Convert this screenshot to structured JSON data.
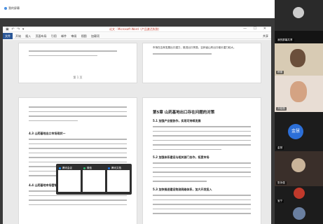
{
  "callbar": {
    "title": "我的屏幕"
  },
  "word": {
    "doc_title": "论文 - Microsoft Word（产品激活失败）",
    "quick_access": "▣ ↶ ↷ ▾",
    "window_controls": "— ☐ ✕",
    "file_tab": "文件",
    "tabs": [
      "开始",
      "插入",
      "页面布局",
      "引用",
      "邮件",
      "审阅",
      "视图",
      "加载项"
    ],
    "share": "共享"
  },
  "pages": {
    "top_right_line": "市场在吉林发展出口潜力，推进出口贸易，吉林省山药出口增长潜力较大。",
    "bl_heading_1": "4.3 山药基地出口市场现状—",
    "bl_heading_2": "4.4 山药基地市场营销现状",
    "br_heading": "第5章 山药基地出口存在问题的对策",
    "br_sub_1": "5.1 加强产业链协作，实现可持续发展",
    "br_sub_2": "5.2 加强体系建设与相关部门合作，拓宽市场",
    "br_sub_3": "5.3 加快推进建设物流网络体系，加大开发投入",
    "page_number": "第 1 页"
  },
  "switcher": {
    "items": [
      {
        "label": "腾讯会议",
        "color": "#1e88e5"
      },
      {
        "label": "微信",
        "color": "#2aae67"
      },
      {
        "label": "腾讯文档",
        "color": "#1e6fd8"
      }
    ]
  },
  "participants": {
    "tiles": [
      {
        "name": "我的屏幕",
        "bg": "#2a2a2a"
      },
      {
        "name": "我的屏幕共享",
        "bg": "#d8cbb4"
      },
      {
        "name": "杨丽",
        "bg": "#6b4f3b"
      },
      {
        "name": "刘佳丽",
        "bg": "#e8ddd4"
      },
      {
        "name": "金慧",
        "bg": "#1c1c1c"
      },
      {
        "name": "张永强",
        "bg": "#3a2f2a"
      },
      {
        "name": "宝宁",
        "bg": "#5a4230"
      },
      {
        "name": "",
        "bg": "#1c1c1c"
      }
    ],
    "gold_avatar_text": "金慧"
  }
}
